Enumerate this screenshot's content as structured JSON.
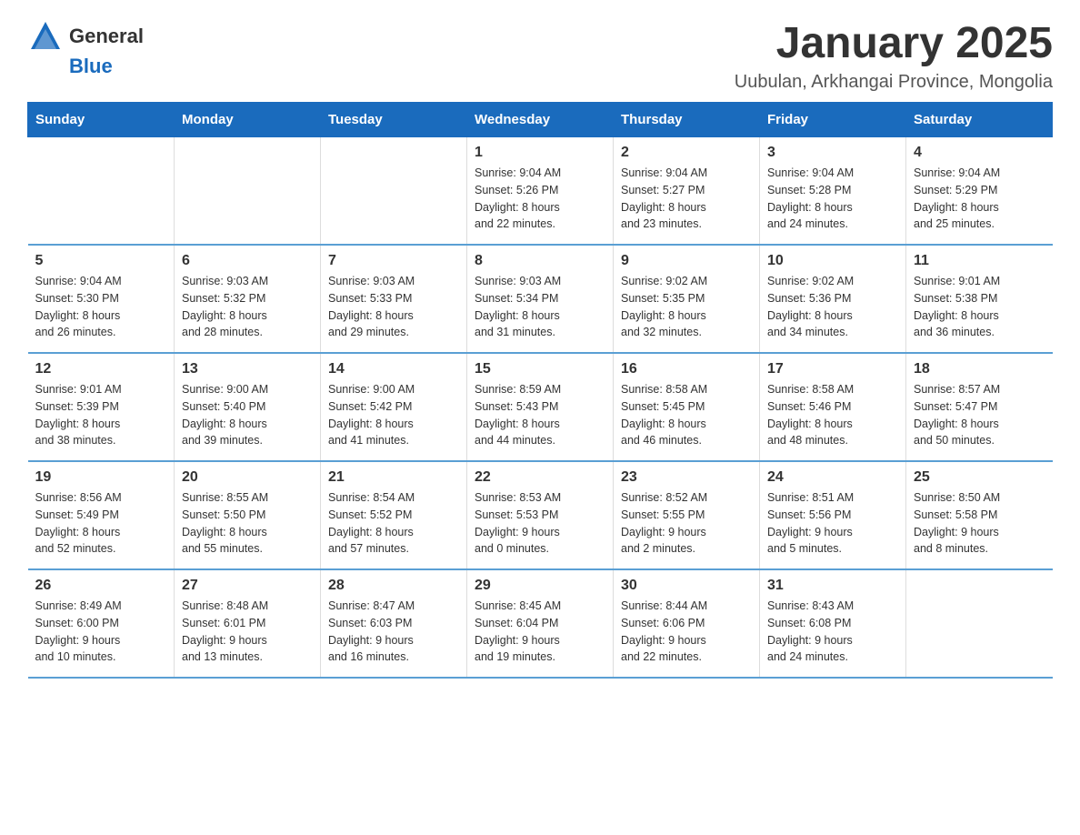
{
  "header": {
    "logo": {
      "text_general": "General",
      "text_blue": "Blue",
      "alt": "GeneralBlue logo"
    },
    "title": "January 2025",
    "location": "Uubulan, Arkhangai Province, Mongolia"
  },
  "calendar": {
    "days_of_week": [
      "Sunday",
      "Monday",
      "Tuesday",
      "Wednesday",
      "Thursday",
      "Friday",
      "Saturday"
    ],
    "weeks": [
      [
        {
          "day": "",
          "info": ""
        },
        {
          "day": "",
          "info": ""
        },
        {
          "day": "",
          "info": ""
        },
        {
          "day": "1",
          "info": "Sunrise: 9:04 AM\nSunset: 5:26 PM\nDaylight: 8 hours\nand 22 minutes."
        },
        {
          "day": "2",
          "info": "Sunrise: 9:04 AM\nSunset: 5:27 PM\nDaylight: 8 hours\nand 23 minutes."
        },
        {
          "day": "3",
          "info": "Sunrise: 9:04 AM\nSunset: 5:28 PM\nDaylight: 8 hours\nand 24 minutes."
        },
        {
          "day": "4",
          "info": "Sunrise: 9:04 AM\nSunset: 5:29 PM\nDaylight: 8 hours\nand 25 minutes."
        }
      ],
      [
        {
          "day": "5",
          "info": "Sunrise: 9:04 AM\nSunset: 5:30 PM\nDaylight: 8 hours\nand 26 minutes."
        },
        {
          "day": "6",
          "info": "Sunrise: 9:03 AM\nSunset: 5:32 PM\nDaylight: 8 hours\nand 28 minutes."
        },
        {
          "day": "7",
          "info": "Sunrise: 9:03 AM\nSunset: 5:33 PM\nDaylight: 8 hours\nand 29 minutes."
        },
        {
          "day": "8",
          "info": "Sunrise: 9:03 AM\nSunset: 5:34 PM\nDaylight: 8 hours\nand 31 minutes."
        },
        {
          "day": "9",
          "info": "Sunrise: 9:02 AM\nSunset: 5:35 PM\nDaylight: 8 hours\nand 32 minutes."
        },
        {
          "day": "10",
          "info": "Sunrise: 9:02 AM\nSunset: 5:36 PM\nDaylight: 8 hours\nand 34 minutes."
        },
        {
          "day": "11",
          "info": "Sunrise: 9:01 AM\nSunset: 5:38 PM\nDaylight: 8 hours\nand 36 minutes."
        }
      ],
      [
        {
          "day": "12",
          "info": "Sunrise: 9:01 AM\nSunset: 5:39 PM\nDaylight: 8 hours\nand 38 minutes."
        },
        {
          "day": "13",
          "info": "Sunrise: 9:00 AM\nSunset: 5:40 PM\nDaylight: 8 hours\nand 39 minutes."
        },
        {
          "day": "14",
          "info": "Sunrise: 9:00 AM\nSunset: 5:42 PM\nDaylight: 8 hours\nand 41 minutes."
        },
        {
          "day": "15",
          "info": "Sunrise: 8:59 AM\nSunset: 5:43 PM\nDaylight: 8 hours\nand 44 minutes."
        },
        {
          "day": "16",
          "info": "Sunrise: 8:58 AM\nSunset: 5:45 PM\nDaylight: 8 hours\nand 46 minutes."
        },
        {
          "day": "17",
          "info": "Sunrise: 8:58 AM\nSunset: 5:46 PM\nDaylight: 8 hours\nand 48 minutes."
        },
        {
          "day": "18",
          "info": "Sunrise: 8:57 AM\nSunset: 5:47 PM\nDaylight: 8 hours\nand 50 minutes."
        }
      ],
      [
        {
          "day": "19",
          "info": "Sunrise: 8:56 AM\nSunset: 5:49 PM\nDaylight: 8 hours\nand 52 minutes."
        },
        {
          "day": "20",
          "info": "Sunrise: 8:55 AM\nSunset: 5:50 PM\nDaylight: 8 hours\nand 55 minutes."
        },
        {
          "day": "21",
          "info": "Sunrise: 8:54 AM\nSunset: 5:52 PM\nDaylight: 8 hours\nand 57 minutes."
        },
        {
          "day": "22",
          "info": "Sunrise: 8:53 AM\nSunset: 5:53 PM\nDaylight: 9 hours\nand 0 minutes."
        },
        {
          "day": "23",
          "info": "Sunrise: 8:52 AM\nSunset: 5:55 PM\nDaylight: 9 hours\nand 2 minutes."
        },
        {
          "day": "24",
          "info": "Sunrise: 8:51 AM\nSunset: 5:56 PM\nDaylight: 9 hours\nand 5 minutes."
        },
        {
          "day": "25",
          "info": "Sunrise: 8:50 AM\nSunset: 5:58 PM\nDaylight: 9 hours\nand 8 minutes."
        }
      ],
      [
        {
          "day": "26",
          "info": "Sunrise: 8:49 AM\nSunset: 6:00 PM\nDaylight: 9 hours\nand 10 minutes."
        },
        {
          "day": "27",
          "info": "Sunrise: 8:48 AM\nSunset: 6:01 PM\nDaylight: 9 hours\nand 13 minutes."
        },
        {
          "day": "28",
          "info": "Sunrise: 8:47 AM\nSunset: 6:03 PM\nDaylight: 9 hours\nand 16 minutes."
        },
        {
          "day": "29",
          "info": "Sunrise: 8:45 AM\nSunset: 6:04 PM\nDaylight: 9 hours\nand 19 minutes."
        },
        {
          "day": "30",
          "info": "Sunrise: 8:44 AM\nSunset: 6:06 PM\nDaylight: 9 hours\nand 22 minutes."
        },
        {
          "day": "31",
          "info": "Sunrise: 8:43 AM\nSunset: 6:08 PM\nDaylight: 9 hours\nand 24 minutes."
        },
        {
          "day": "",
          "info": ""
        }
      ]
    ]
  }
}
